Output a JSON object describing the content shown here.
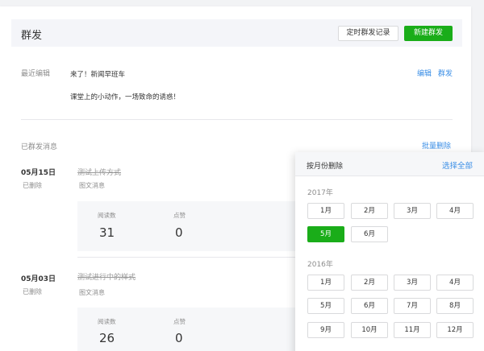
{
  "header": {
    "title": "群发",
    "scheduled_button": "定时群发记录",
    "new_button": "新建群发"
  },
  "recent": {
    "label": "最近编辑",
    "line1": "来了！新闻早班车",
    "line2": "课堂上的小动作，一场致命的诱惑！",
    "edit_link": "编辑",
    "send_link": "群发"
  },
  "sent": {
    "label": "已群发消息",
    "batch_delete": "批量删除",
    "items": [
      {
        "date": "05月15日",
        "status": "已删除",
        "title": "测试上传方式",
        "type": "图文消息",
        "reads_label": "阅读数",
        "reads": "31",
        "likes_label": "点赞",
        "likes": "0"
      },
      {
        "date": "05月03日",
        "status": "已删除",
        "title": "测试进行中的样式",
        "type": "图文消息",
        "reads_label": "阅读数",
        "reads": "26",
        "likes_label": "点赞",
        "likes": "0"
      }
    ]
  },
  "panel": {
    "title": "按月份删除",
    "select_all": "选择全部",
    "years": [
      {
        "year": "2017年",
        "months": [
          "1月",
          "2月",
          "3月",
          "4月",
          "5月",
          "6月"
        ],
        "selected": "5月"
      },
      {
        "year": "2016年",
        "months": [
          "1月",
          "2月",
          "3月",
          "4月",
          "5月",
          "6月",
          "7月",
          "8月",
          "9月",
          "10月",
          "11月",
          "12月"
        ]
      }
    ]
  },
  "colors": {
    "primary": "#1aad19",
    "link": "#3a8ee6"
  }
}
